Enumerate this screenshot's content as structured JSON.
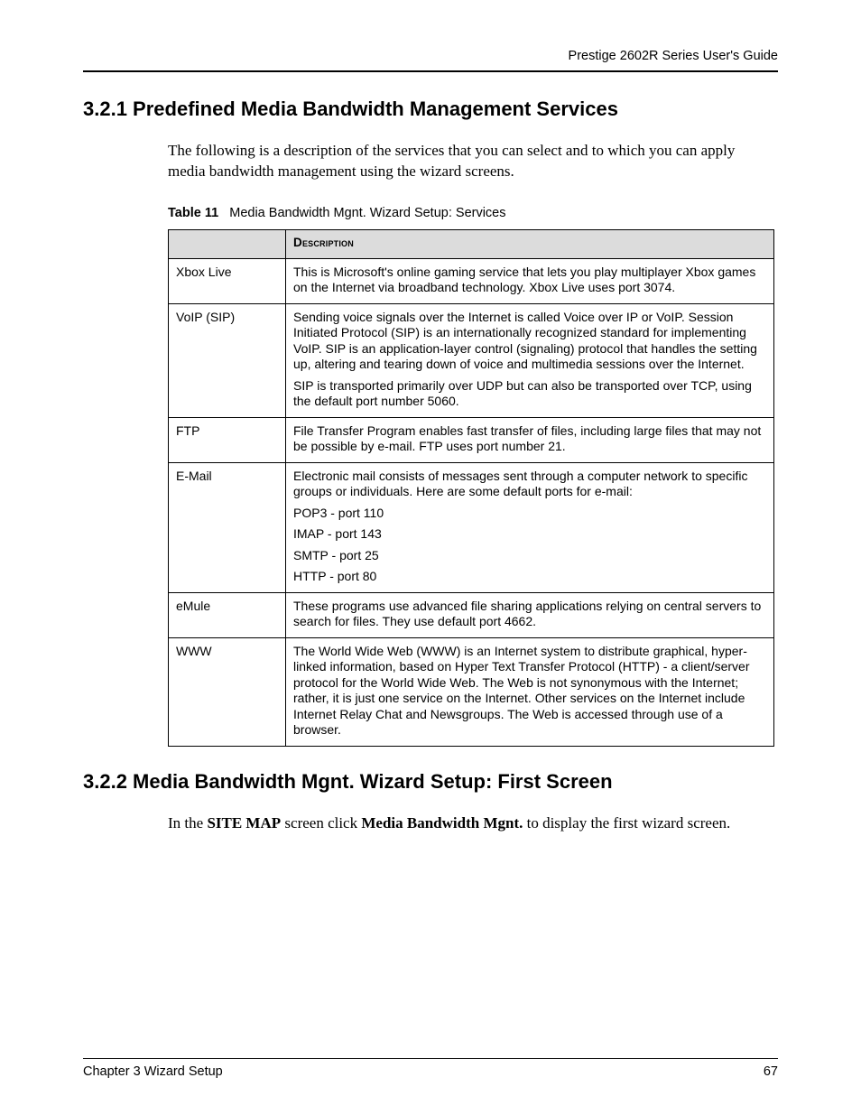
{
  "running_head": "Prestige 2602R Series User's Guide",
  "section1": {
    "heading": "3.2.1  Predefined Media Bandwidth Management Services",
    "para": "The following is a description of the services that you can select and to which you can apply media bandwidth management using the wizard screens."
  },
  "table": {
    "caption_label": "Table 11",
    "caption_text": "Media Bandwidth Mgnt. Wizard Setup: Services",
    "header_col1": "",
    "header_col2": "Description",
    "rows": [
      {
        "name": "Xbox Live",
        "desc": [
          "This is Microsoft's online gaming service that lets you play multiplayer Xbox games on the Internet via broadband technology. Xbox Live uses port 3074."
        ]
      },
      {
        "name": "VoIP (SIP)",
        "desc": [
          "Sending voice signals over the Internet is called Voice over IP or VoIP. Session Initiated Protocol  (SIP) is an internationally recognized standard for implementing VoIP. SIP is an application-layer control (signaling) protocol that handles the setting up, altering and tearing down of voice and multimedia sessions over the Internet.",
          "SIP is transported primarily over UDP but can also be transported over TCP, using the default port number 5060."
        ]
      },
      {
        "name": "FTP",
        "desc": [
          "File Transfer Program enables fast transfer of files, including large files that may not be possible by e-mail. FTP uses port number 21."
        ]
      },
      {
        "name": "E-Mail",
        "desc": [
          "Electronic mail consists of messages sent through a computer network to specific groups or individuals. Here are some default ports for e-mail:",
          "POP3 - port 110",
          "IMAP - port 143",
          "SMTP - port 25",
          "HTTP - port 80"
        ]
      },
      {
        "name": "eMule",
        "desc": [
          "These programs use advanced file sharing applications relying on central servers to search for files. They use default port 4662."
        ]
      },
      {
        "name": "WWW",
        "desc": [
          "The World Wide Web (WWW) is an Internet system to distribute graphical, hyper-linked information, based on Hyper Text Transfer Protocol (HTTP) - a client/server protocol for the World Wide Web. The Web is not synonymous with the Internet; rather, it is just one service on the Internet. Other services on the Internet include Internet Relay Chat and Newsgroups. The Web is accessed through use of a browser."
        ]
      }
    ]
  },
  "section2": {
    "heading": "3.2.2  Media Bandwidth Mgnt. Wizard Setup: First Screen",
    "para_pre": "In the ",
    "para_b1": "SITE MAP",
    "para_mid": " screen click ",
    "para_b2": "Media Bandwidth Mgnt.",
    "para_post": " to display the first wizard screen."
  },
  "footer": {
    "left": "Chapter 3 Wizard Setup",
    "right": "67"
  }
}
